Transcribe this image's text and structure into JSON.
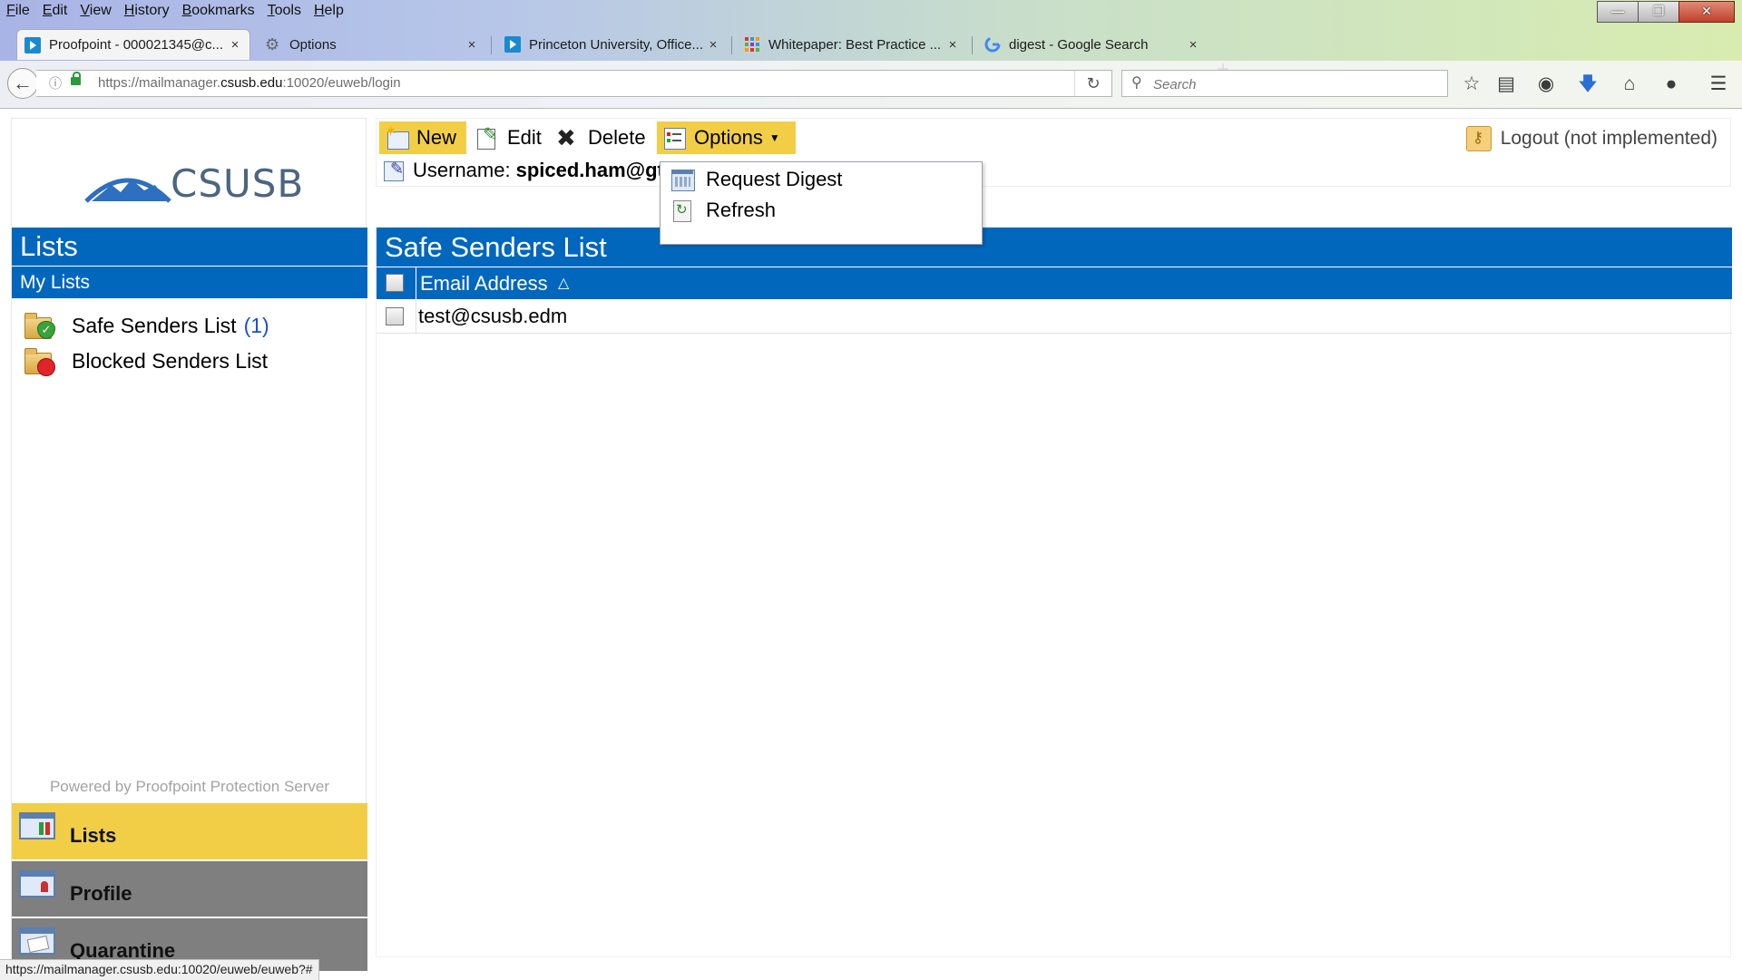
{
  "browser": {
    "menu": [
      "File",
      "Edit",
      "View",
      "History",
      "Bookmarks",
      "Tools",
      "Help"
    ],
    "tabs": [
      {
        "label": "Proofpoint - 000021345@c...",
        "icon": "proofpoint-icon",
        "active": true
      },
      {
        "label": "Options",
        "icon": "gear-icon",
        "active": false
      },
      {
        "label": "Princeton University, Office...",
        "icon": "proofpoint-icon",
        "active": false
      },
      {
        "label": "Whitepaper: Best Practice ...",
        "icon": "grid-dots-icon",
        "active": false
      },
      {
        "label": "digest - Google Search",
        "icon": "google-icon",
        "active": false
      }
    ],
    "url_prefix": "https://mailmanager.",
    "url_domain": "csusb.edu",
    "url_suffix": ":10020/euweb/login",
    "search_placeholder": "Search",
    "status_url": "https://mailmanager.csusb.edu:10020/euweb/euweb?#"
  },
  "logo": {
    "brand": "CSUSB"
  },
  "sidebar": {
    "header": "Lists",
    "subheader": "My Lists",
    "items": [
      {
        "label": "Safe Senders List",
        "count": "(1)"
      },
      {
        "label": "Blocked Senders List",
        "count": ""
      }
    ],
    "powered_by": "Powered by Proofpoint Protection Server",
    "nav": [
      {
        "label": "Lists",
        "active": true
      },
      {
        "label": "Profile",
        "active": false
      },
      {
        "label": "Quarantine",
        "active": false
      }
    ]
  },
  "toolbar": {
    "new_label": "New",
    "edit_label": "Edit",
    "delete_label": "Delete",
    "options_label": "Options",
    "username_label": "Username:",
    "username_value": "spiced.ham@gt",
    "logout_label": "Logout (not implemented)"
  },
  "options_menu": {
    "items": [
      "Request Digest",
      "Refresh"
    ]
  },
  "main": {
    "title": "Safe Senders List",
    "column": "Email Address",
    "sort_glyph": "△",
    "rows": [
      "test@csusb.edm"
    ]
  },
  "colors": {
    "header_blue": "#0067bd",
    "highlight_yellow": "#f2ce47",
    "inactive_nav_gray": "#7f7f7f"
  }
}
